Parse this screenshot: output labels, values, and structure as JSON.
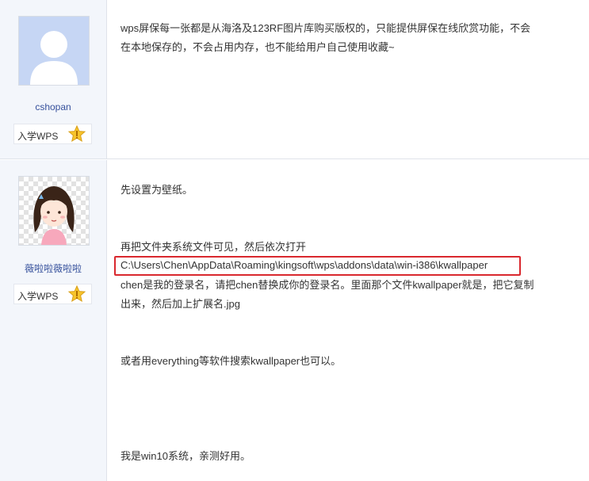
{
  "posts": [
    {
      "user": {
        "name": "cshopan",
        "rank": "入学WPS",
        "rank_icon": "star-icon",
        "avatar": "default-avatar"
      },
      "content": {
        "line1": "wps屏保每一张都是从海洛及123RF图片库购买版权的，只能提供屏保在线欣赏功能，不会",
        "line2": "在本地保存的，不会占用内存，也不能给用户自己使用收藏~"
      }
    },
    {
      "user": {
        "name": "薇啦啦薇啦啦",
        "rank": "入学WPS",
        "rank_icon": "star-icon",
        "avatar": "cartoon-girl-avatar"
      },
      "content": {
        "p1": "先设置为壁纸。",
        "p2": "再把文件夹系统文件可见，然后依次打开",
        "path": "C:\\Users\\Chen\\AppData\\Roaming\\kingsoft\\wps\\addons\\data\\win-i386\\kwallpaper",
        "p3a": "chen是我的登录名，请把chen替换成你的登录名。里面那个文件kwallpaper就是，把它复制",
        "p3b": "出来，然后加上扩展名.jpg",
        "p4": "或者用everything等软件搜索kwallpaper也可以。",
        "p5": "我是win10系统，亲测好用。"
      }
    }
  ],
  "colors": {
    "username": "#36519c",
    "highlight": "#d9282e",
    "sidebar_bg": "#f3f6fb"
  }
}
